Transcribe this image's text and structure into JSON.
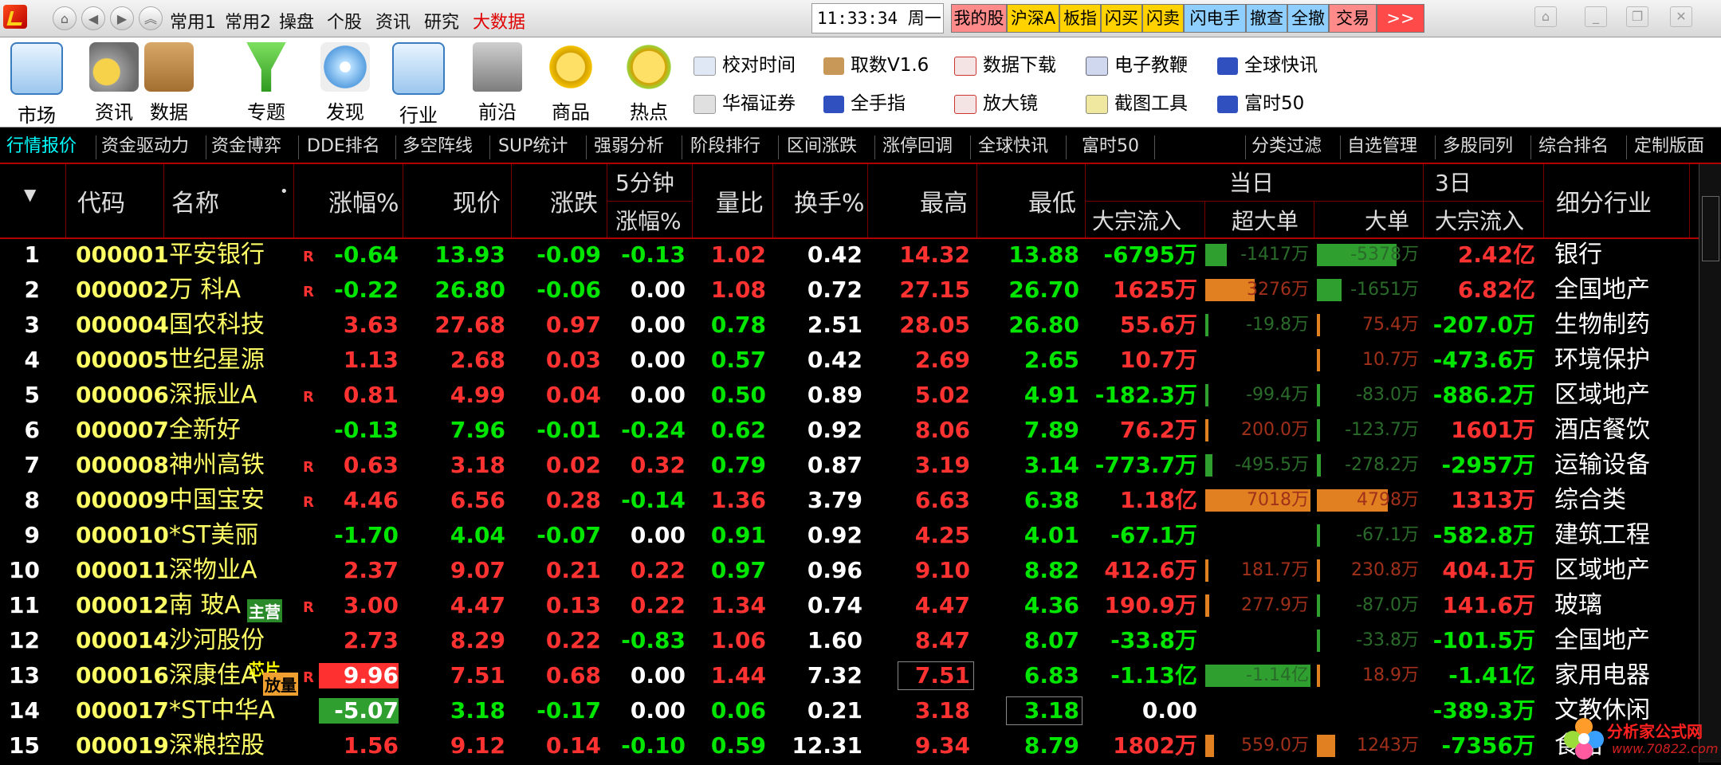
{
  "menubar": {
    "items": [
      "常用1",
      "常用2",
      "操盘",
      "个股",
      "资讯",
      "研究",
      "大数据"
    ],
    "active_item": "大数据",
    "clock": "11:33:34 周一",
    "quick_buttons": [
      "我的股",
      "沪深A",
      "板指",
      "闪买",
      "闪卖",
      "闪电手",
      "撤查",
      "全撤",
      "交易",
      ">>"
    ]
  },
  "toolbar": {
    "big_tools": [
      "市场",
      "资讯",
      "数据",
      "专题",
      "发现",
      "行业",
      "前沿",
      "商品",
      "热点"
    ],
    "small_tools_row1": [
      "校对时间",
      "取数V1.6",
      "数据下载",
      "电子教鞭",
      "全球快讯"
    ],
    "small_tools_row2": [
      "华福证券",
      "全手指",
      "放大镜",
      "截图工具",
      "富时50"
    ]
  },
  "tabs": {
    "left": [
      "行情报价",
      "资金驱动力",
      "资金博弈",
      "DDE排名",
      "多空阵线",
      "SUP统计",
      "强弱分析",
      "阶段排行",
      "区间涨跌",
      "涨停回调",
      "全球快讯",
      "富时50"
    ],
    "active": "行情报价",
    "right": [
      "分类过滤",
      "自选管理",
      "多股同列",
      "综合排名",
      "定制版面"
    ]
  },
  "table_header": {
    "code": "代码",
    "name": "名称",
    "name_marker": "•",
    "change_pct": "涨幅%",
    "price": "现价",
    "change": "涨跌",
    "five_min_line1": "5分钟",
    "five_min_line2": "涨幅%",
    "volume_ratio": "量比",
    "turnover": "换手%",
    "high": "最高",
    "low": "最低",
    "today_group": "当日",
    "block_inflow": "大宗流入",
    "super_large": "超大单",
    "large": "大单",
    "three_day_group": "3日",
    "block_inflow_3d": "大宗流入",
    "industry": "细分行业"
  },
  "rows": [
    {
      "idx": "1",
      "code": "000001",
      "name": "平安银行",
      "tag": "R",
      "chg": "-0.64",
      "price": "13.93",
      "diff": "-0.09",
      "m5": "-0.13",
      "vr": "1.02",
      "to": "0.42",
      "high": "14.32",
      "low": "13.88",
      "inflow": "-6795万",
      "sl": "-1417万",
      "lg": "-5378万",
      "in3": "2.42亿",
      "ind": "银行"
    },
    {
      "idx": "2",
      "code": "000002",
      "name": "万 科A",
      "tag": "R",
      "chg": "-0.22",
      "price": "26.80",
      "diff": "-0.06",
      "m5": "0.00",
      "vr": "1.08",
      "to": "0.72",
      "high": "27.15",
      "low": "26.70",
      "inflow": "1625万",
      "sl": "3276万",
      "lg": "-1651万",
      "in3": "6.82亿",
      "ind": "全国地产"
    },
    {
      "idx": "3",
      "code": "000004",
      "name": "国农科技",
      "tag": "",
      "chg": "3.63",
      "price": "27.68",
      "diff": "0.97",
      "m5": "0.00",
      "vr": "0.78",
      "to": "2.51",
      "high": "28.05",
      "low": "26.80",
      "inflow": "55.6万",
      "sl": "-19.8万",
      "lg": "75.4万",
      "in3": "-207.0万",
      "ind": "生物制药"
    },
    {
      "idx": "4",
      "code": "000005",
      "name": "世纪星源",
      "tag": "",
      "chg": "1.13",
      "price": "2.68",
      "diff": "0.03",
      "m5": "0.00",
      "vr": "0.57",
      "to": "0.42",
      "high": "2.69",
      "low": "2.65",
      "inflow": "10.7万",
      "sl": "",
      "lg": "10.7万",
      "in3": "-473.6万",
      "ind": "环境保护"
    },
    {
      "idx": "5",
      "code": "000006",
      "name": "深振业A",
      "tag": "R",
      "chg": "0.81",
      "price": "4.99",
      "diff": "0.04",
      "m5": "0.00",
      "vr": "0.50",
      "to": "0.89",
      "high": "5.02",
      "low": "4.91",
      "inflow": "-182.3万",
      "sl": "-99.4万",
      "lg": "-83.0万",
      "in3": "-886.2万",
      "ind": "区域地产"
    },
    {
      "idx": "6",
      "code": "000007",
      "name": "全新好",
      "tag": "",
      "chg": "-0.13",
      "price": "7.96",
      "diff": "-0.01",
      "m5": "-0.24",
      "vr": "0.62",
      "to": "0.92",
      "high": "8.06",
      "low": "7.89",
      "inflow": "76.2万",
      "sl": "200.0万",
      "lg": "-123.7万",
      "in3": "1601万",
      "ind": "酒店餐饮"
    },
    {
      "idx": "7",
      "code": "000008",
      "name": "神州高铁",
      "tag": "R",
      "chg": "0.63",
      "price": "3.18",
      "diff": "0.02",
      "m5": "0.32",
      "vr": "0.79",
      "to": "0.87",
      "high": "3.19",
      "low": "3.14",
      "inflow": "-773.7万",
      "sl": "-495.5万",
      "lg": "-278.2万",
      "in3": "-2957万",
      "ind": "运输设备"
    },
    {
      "idx": "8",
      "code": "000009",
      "name": "中国宝安",
      "tag": "R",
      "chg": "4.46",
      "price": "6.56",
      "diff": "0.28",
      "m5": "-0.14",
      "vr": "1.36",
      "to": "3.79",
      "high": "6.63",
      "low": "6.38",
      "inflow": "1.18亿",
      "sl": "7018万",
      "lg": "4798万",
      "in3": "1313万",
      "ind": "综合类"
    },
    {
      "idx": "9",
      "code": "000010",
      "name": "*ST美丽",
      "tag": "",
      "chg": "-1.70",
      "price": "4.04",
      "diff": "-0.07",
      "m5": "0.00",
      "vr": "0.91",
      "to": "0.92",
      "high": "4.25",
      "low": "4.01",
      "inflow": "-67.1万",
      "sl": "",
      "lg": "-67.1万",
      "in3": "-582.8万",
      "ind": "建筑工程"
    },
    {
      "idx": "10",
      "code": "000011",
      "name": "深物业A",
      "tag": "",
      "chg": "2.37",
      "price": "9.07",
      "diff": "0.21",
      "m5": "0.22",
      "vr": "0.97",
      "to": "0.96",
      "high": "9.10",
      "low": "8.82",
      "inflow": "412.6万",
      "sl": "181.7万",
      "lg": "230.8万",
      "in3": "404.1万",
      "ind": "区域地产"
    },
    {
      "idx": "11",
      "code": "000012",
      "name": "南 玻A",
      "tag": "R",
      "badge": "主营",
      "chg": "3.00",
      "price": "4.47",
      "diff": "0.13",
      "m5": "0.22",
      "vr": "1.34",
      "to": "0.74",
      "high": "4.47",
      "low": "4.36",
      "inflow": "190.9万",
      "sl": "277.9万",
      "lg": "-87.0万",
      "in3": "141.6万",
      "ind": "玻璃"
    },
    {
      "idx": "12",
      "code": "000014",
      "name": "沙河股份",
      "tag": "",
      "chg": "2.73",
      "price": "8.29",
      "diff": "0.22",
      "m5": "-0.83",
      "vr": "1.06",
      "to": "1.60",
      "high": "8.47",
      "low": "8.07",
      "inflow": "-33.8万",
      "sl": "",
      "lg": "-33.8万",
      "in3": "-101.5万",
      "ind": "全国地产"
    },
    {
      "idx": "13",
      "code": "000016",
      "name": "深康佳A",
      "tag": "R",
      "badge": "芯片",
      "badge2": "放量",
      "chg": "9.96",
      "price": "7.51",
      "diff": "0.68",
      "m5": "0.00",
      "vr": "1.44",
      "to": "7.32",
      "high": "7.51",
      "low": "6.83",
      "inflow": "-1.13亿",
      "sl": "-1.14亿",
      "lg": "18.9万",
      "in3": "-1.41亿",
      "ind": "家用电器"
    },
    {
      "idx": "14",
      "code": "000017",
      "name": "*ST中华A",
      "tag": "",
      "chg": "-5.07",
      "price": "3.18",
      "diff": "-0.17",
      "m5": "0.00",
      "vr": "0.06",
      "to": "0.21",
      "high": "3.18",
      "low": "3.18",
      "inflow": "0.00",
      "sl": "",
      "lg": "",
      "in3": "-389.3万",
      "ind": "文教休闲"
    },
    {
      "idx": "15",
      "code": "000019",
      "name": "深粮控股",
      "tag": "",
      "chg": "1.56",
      "price": "9.12",
      "diff": "0.14",
      "m5": "-0.10",
      "vr": "0.59",
      "to": "12.31",
      "high": "9.34",
      "low": "8.79",
      "inflow": "1802万",
      "sl": "559.0万",
      "lg": "1243万",
      "in3": "-7356万",
      "ind": "食品"
    }
  ],
  "watermark": {
    "line1": "分析家公式网",
    "line2": "www.70822.com"
  },
  "colors": {
    "up": "#ff3232",
    "down": "#00e600",
    "code": "#ffff66",
    "inflow_bar": "#e08020",
    "outflow_bar": "#2fa02f",
    "limit_up_bg": "#ff3030",
    "limit_down_bg": "#2fa02f"
  }
}
